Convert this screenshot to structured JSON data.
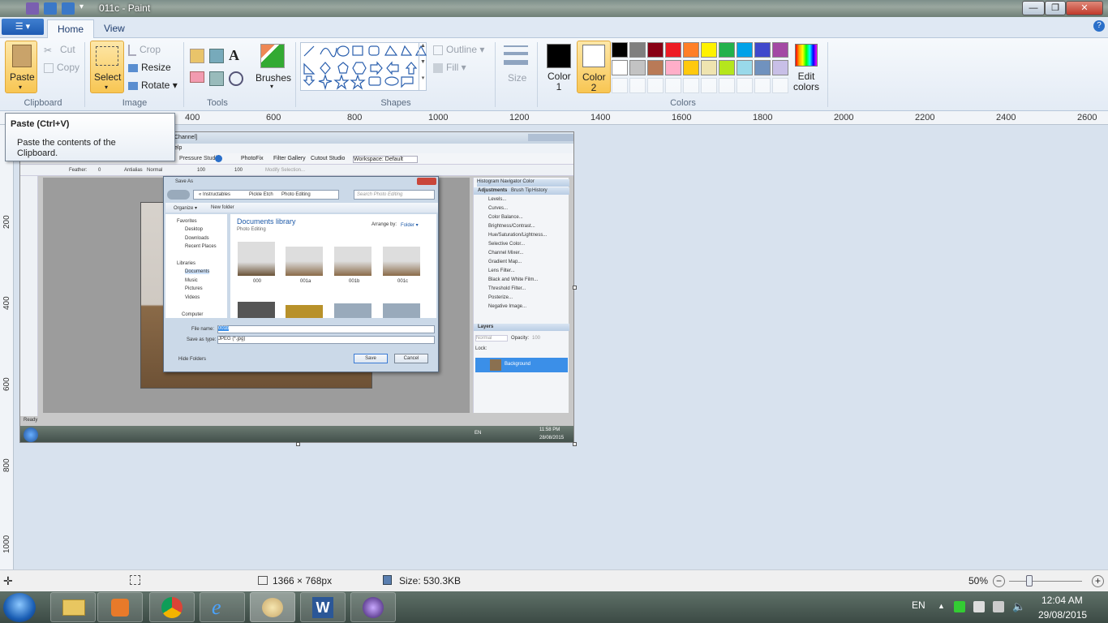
{
  "window": {
    "title": "011c - Paint",
    "min": "—",
    "max": "❐",
    "close": "✕",
    "help": "?"
  },
  "tabs": {
    "file": "☰ ▾",
    "home": "Home",
    "view": "View"
  },
  "clipboard": {
    "paste": "Paste",
    "cut": "Cut",
    "copy": "Copy",
    "group": "Clipboard"
  },
  "image": {
    "select": "Select",
    "crop": "Crop",
    "resize": "Resize",
    "rotate": "Rotate",
    "group": "Image"
  },
  "tools": {
    "group": "Tools",
    "brushes": "Brushes"
  },
  "shapes": {
    "outline": "Outline",
    "fill": "Fill",
    "size": "Size",
    "group": "Shapes"
  },
  "colors": {
    "color1": "Color\n1",
    "color1_a": "Color",
    "color1_b": "1",
    "color2_a": "Color",
    "color2_b": "2",
    "edit_a": "Edit",
    "edit_b": "colors",
    "group": "Colors",
    "row1": [
      "#000000",
      "#7f7f7f",
      "#880015",
      "#ed1c24",
      "#ff7f27",
      "#fff200",
      "#22b14c",
      "#00a2e8",
      "#3f48cc",
      "#a349a4"
    ],
    "row2": [
      "#ffffff",
      "#c3c3c3",
      "#b97a57",
      "#ffaec9",
      "#ffc90e",
      "#efe4b0",
      "#b5e61d",
      "#99d9ea",
      "#7092be",
      "#c8bfe7"
    ]
  },
  "ruler": {
    "ticks": [
      "400",
      "600",
      "800",
      "1000",
      "1200",
      "1400",
      "1600",
      "1800",
      "2000",
      "2200",
      "2400",
      "2600"
    ],
    "vticks": [
      "200",
      "400",
      "600",
      "800",
      "1000"
    ]
  },
  "tooltip": {
    "title": "Paste (Ctrl+V)",
    "body1": "Paste the contents of the",
    "body2": "Clipboard."
  },
  "status": {
    "dims": "1366 × 768px",
    "size": "Size: 530.3KB",
    "zoom": "50%"
  },
  "taskbar": {
    "lang": "EN",
    "time": "12:04 AM",
    "date": "29/08/2015"
  },
  "inner": {
    "menu_channel": "Channel]",
    "menu_help": "elp",
    "toolbar_items": [
      "Pressure Studio",
      "PhotoFix",
      "Filter Gallery",
      "Cutout Studio",
      "Workspace: Default"
    ],
    "options": [
      "Feather:",
      "0",
      "Antialias",
      "Normal",
      "100",
      "100",
      "Modify Selection..."
    ],
    "panel_tabs": "Histogram  Navigator  Color",
    "adj_tabs": [
      "Adjustments",
      "Brush Tip",
      "History"
    ],
    "adjustments": [
      "Levels...",
      "Curves...",
      "Color Balance...",
      "Brightness/Contrast...",
      "Hue/Saturation/Lightness...",
      "Selective Color...",
      "Channel Mixer...",
      "Gradient Map...",
      "Lens Filter...",
      "Black and White Film...",
      "Threshold Filter...",
      "Posterize...",
      "Negative Image..."
    ],
    "layers": "Layers",
    "layer_mode": "Normal",
    "opacity": "Opacity:",
    "opacity_val": "100",
    "lock": "Lock:",
    "layer_name": "Background",
    "ready": "Ready",
    "tb_lang": "EN",
    "tb_time": "11:58 PM",
    "tb_date": "28/08/2015"
  },
  "saveas": {
    "title": "Save As",
    "path": [
      "«  Instructables",
      "Pickle Etch",
      "Photo Editing"
    ],
    "search": "Search Photo Editing",
    "organize": "Organize ▾",
    "newfolder": "New folder",
    "favorites": "Favorites",
    "fav_items": [
      "Desktop",
      "Downloads",
      "Recent Places"
    ],
    "libraries": "Libraries",
    "lib_items": [
      "Documents",
      "Music",
      "Pictures",
      "Videos"
    ],
    "computer": "Computer",
    "lib_title": "Documents library",
    "lib_sub": "Photo Editing",
    "arrange": "Arrange by:",
    "arrange_val": "Folder ▾",
    "files": [
      "000",
      "001a",
      "001b",
      "001c"
    ],
    "filename_label": "File name:",
    "filename": "001b",
    "type_label": "Save as type:",
    "type": "JPEG (*.jpg)",
    "hide": "Hide Folders",
    "save": "Save",
    "cancel": "Cancel"
  }
}
